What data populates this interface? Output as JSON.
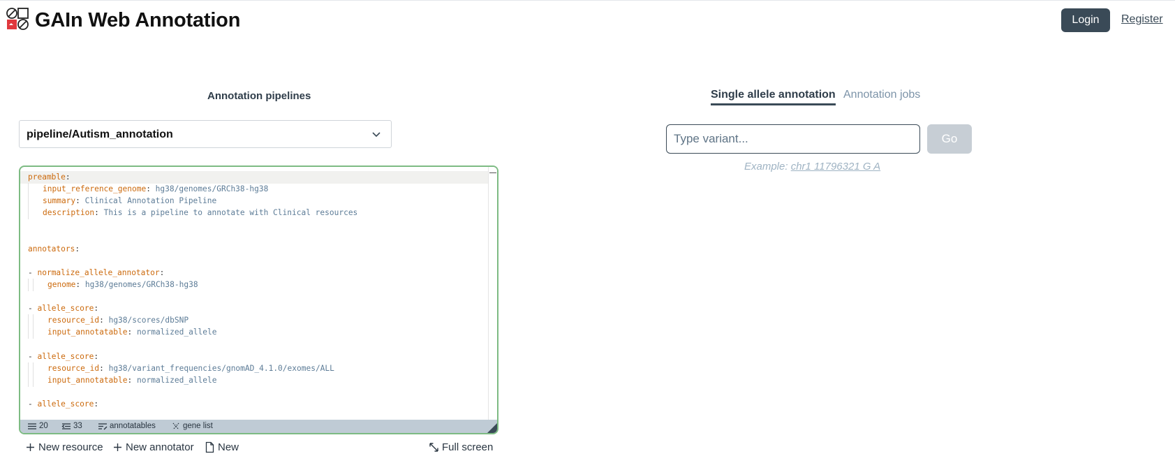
{
  "app": {
    "title": "GAIn Web Annotation"
  },
  "header": {
    "login_label": "Login",
    "register_label": "Register"
  },
  "pipelines": {
    "heading": "Annotation pipelines",
    "selected": "pipeline/Autism_annotation"
  },
  "editor": {
    "lines": [
      [
        [
          "k",
          "preamble"
        ],
        [
          "p",
          ":"
        ]
      ],
      [
        [
          "k",
          "input_reference_genome"
        ],
        [
          "p",
          ": "
        ],
        [
          "v",
          "hg38/genomes/GRCh38-hg38"
        ]
      ],
      [
        [
          "k",
          "summary"
        ],
        [
          "p",
          ": "
        ],
        [
          "v",
          "Clinical Annotation Pipeline"
        ]
      ],
      [
        [
          "k",
          "description"
        ],
        [
          "p",
          ": "
        ],
        [
          "v",
          "This is a pipeline to annotate with Clinical resources"
        ]
      ],
      [],
      [],
      [
        [
          "k",
          "annotators"
        ],
        [
          "p",
          ":"
        ]
      ],
      [],
      [
        [
          "p",
          "- "
        ],
        [
          "k",
          "normalize_allele_annotator"
        ],
        [
          "p",
          ":"
        ]
      ],
      [
        [
          "k",
          "genome"
        ],
        [
          "p",
          ": "
        ],
        [
          "v",
          "hg38/genomes/GRCh38-hg38"
        ]
      ],
      [],
      [
        [
          "p",
          "- "
        ],
        [
          "k",
          "allele_score"
        ],
        [
          "p",
          ":"
        ]
      ],
      [
        [
          "k",
          "resource_id"
        ],
        [
          "p",
          ": "
        ],
        [
          "v",
          "hg38/scores/dbSNP"
        ]
      ],
      [
        [
          "k",
          "input_annotatable"
        ],
        [
          "p",
          ": "
        ],
        [
          "v",
          "normalized_allele"
        ]
      ],
      [],
      [
        [
          "p",
          "- "
        ],
        [
          "k",
          "allele_score"
        ],
        [
          "p",
          ":"
        ]
      ],
      [
        [
          "k",
          "resource_id"
        ],
        [
          "p",
          ": "
        ],
        [
          "v",
          "hg38/variant_frequencies/gnomAD_4.1.0/exomes/ALL"
        ]
      ],
      [
        [
          "k",
          "input_annotatable"
        ],
        [
          "p",
          ": "
        ],
        [
          "v",
          "normalized_allele"
        ]
      ],
      [],
      [
        [
          "p",
          "- "
        ],
        [
          "k",
          "allele_score"
        ],
        [
          "p",
          ":"
        ]
      ]
    ],
    "status": {
      "lines": "20",
      "columns": "33",
      "annotatables_label": "annotatables",
      "gene_list_label": "gene list"
    }
  },
  "actions": {
    "new_resource": "New resource",
    "new_annotator": "New annotator",
    "new": "New",
    "full_screen": "Full screen"
  },
  "single_allele": {
    "tab_active": "Single allele annotation",
    "tab_jobs": "Annotation jobs",
    "input_placeholder": "Type variant...",
    "go_label": "Go",
    "example_prefix": "Example: ",
    "example_value": "chr1 11796321 G A"
  }
}
